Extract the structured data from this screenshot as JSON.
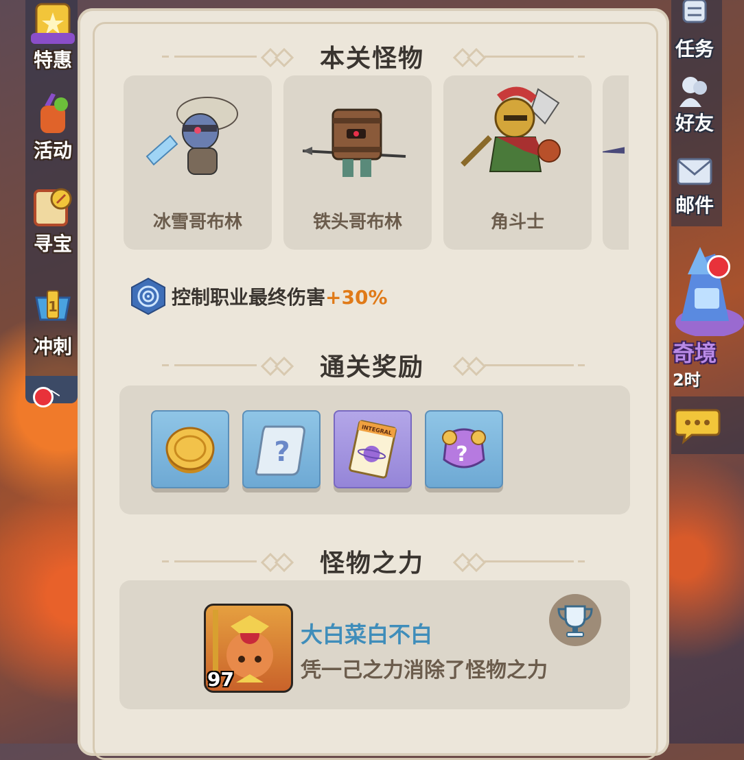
{
  "left_menu": [
    {
      "label": "特惠",
      "icon": "gift-card-icon"
    },
    {
      "label": "活动",
      "icon": "drink-icon"
    },
    {
      "label": "寻宝",
      "icon": "treasure-map-icon"
    },
    {
      "label": "冲刺",
      "icon": "trophy-rank-icon"
    }
  ],
  "right_menu": [
    {
      "label": "任务",
      "icon": "task-list-icon"
    },
    {
      "label": "好友",
      "icon": "friends-icon"
    },
    {
      "label": "邮件",
      "icon": "mail-icon"
    }
  ],
  "secret_realm": {
    "label": "奇境",
    "timer": "2时"
  },
  "sections": {
    "monsters_title": "本关怪物",
    "rewards_title": "通关奖励",
    "power_title": "怪物之力"
  },
  "monsters": [
    {
      "name": "冰雪哥布林",
      "icon": "ice-goblin-icon"
    },
    {
      "name": "铁头哥布林",
      "icon": "barrel-goblin-icon"
    },
    {
      "name": "角斗士",
      "icon": "gladiator-icon"
    }
  ],
  "bonus": {
    "text": "控制职业最终伤害",
    "value": "+30%",
    "icon": "spiral-hex-icon"
  },
  "rewards": [
    {
      "icon": "gold-coin-icon",
      "style": "blue"
    },
    {
      "icon": "mystery-scroll-icon",
      "style": "blue"
    },
    {
      "icon": "integral-ticket-icon",
      "style": "purple",
      "ticket_text": "INTEGRAL"
    },
    {
      "icon": "mystery-armor-icon",
      "style": "blue"
    }
  ],
  "power": {
    "player_name": "大白菜白不白",
    "player_level": "97",
    "description": "凭一己之力消除了怪物之力",
    "badge_icon": "trophy-icon"
  },
  "colors": {
    "accent_orange": "#e07a18",
    "player_blue": "#3f8dba",
    "panel_bg": "#ece6da"
  }
}
